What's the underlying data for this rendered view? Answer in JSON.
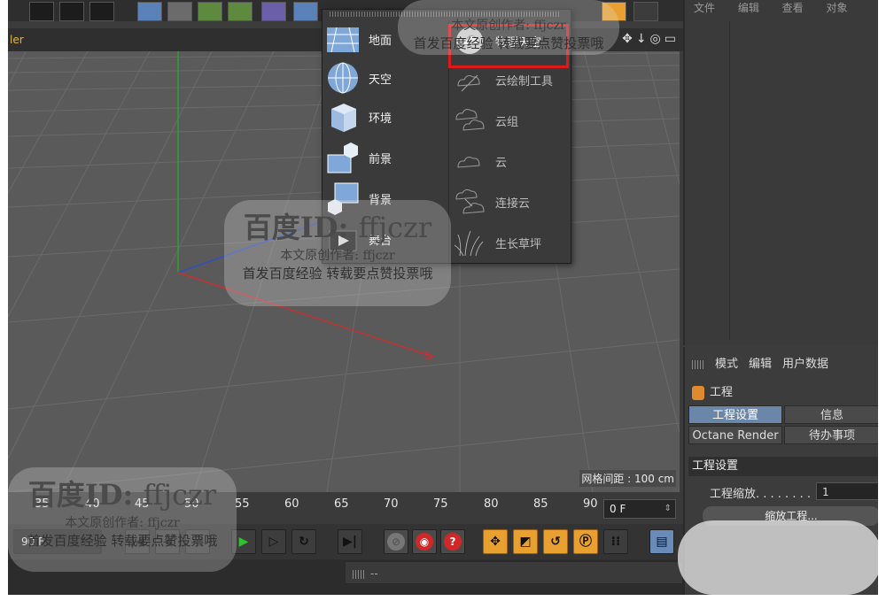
{
  "viewport": {
    "tab_label": "ler",
    "grid_spacing": "网格间距 : 100 cm"
  },
  "popup": {
    "left_items": [
      {
        "label": "地面",
        "icon": "floor-icon"
      },
      {
        "label": "天空",
        "icon": "sky-sphere-icon"
      },
      {
        "label": "环境",
        "icon": "environment-cube-icon"
      },
      {
        "label": "前景",
        "icon": "foreground-icon"
      },
      {
        "label": "背景",
        "icon": "background-icon"
      },
      {
        "label": "舞台",
        "icon": "stage-icon"
      }
    ],
    "right_items": [
      {
        "label": "物理天空",
        "icon": "physical-sky-icon"
      },
      {
        "label": "云绘制工具",
        "icon": "cloud-paint-icon"
      },
      {
        "label": "云组",
        "icon": "cloud-group-icon"
      },
      {
        "label": "云",
        "icon": "cloud-icon"
      },
      {
        "label": "连接云",
        "icon": "connect-clouds-icon"
      },
      {
        "label": "生长草坪",
        "icon": "grass-icon"
      }
    ]
  },
  "right_panel": {
    "menu": "文件 编辑 查看 对象"
  },
  "attributes": {
    "menu": [
      "模式",
      "编辑",
      "用户数据"
    ],
    "header": "工程",
    "tabs": [
      "工程设置",
      "信息",
      "Octane Render",
      "待办事项"
    ],
    "section_title": "工程设置",
    "scale_label": "工程缩放. . . . . . . .",
    "scale_value": "1",
    "scale_button": "缩放工程..."
  },
  "timeline": {
    "ticks": [
      "35",
      "40",
      "45",
      "50",
      "55",
      "60",
      "65",
      "70",
      "75",
      "80",
      "85",
      "90"
    ],
    "frame_value": "0 F",
    "range_value": "90 F"
  },
  "status": {
    "placeholder": "--"
  },
  "watermark": {
    "brand": "百度",
    "id_label": "ID:",
    "user": "ffjczr",
    "author": "本文原创作者: ffjczr",
    "notice": "首发百度经验 转载要点赞投票哦"
  },
  "colors": {
    "highlight_box": "#e01818",
    "axis_x": "#c83030",
    "axis_y": "#30a030",
    "axis_z": "#3050c0",
    "viewport_bg": "#5a5a5a",
    "panel_bg": "#3c3c3c",
    "active_tab": "#6a86a8"
  }
}
